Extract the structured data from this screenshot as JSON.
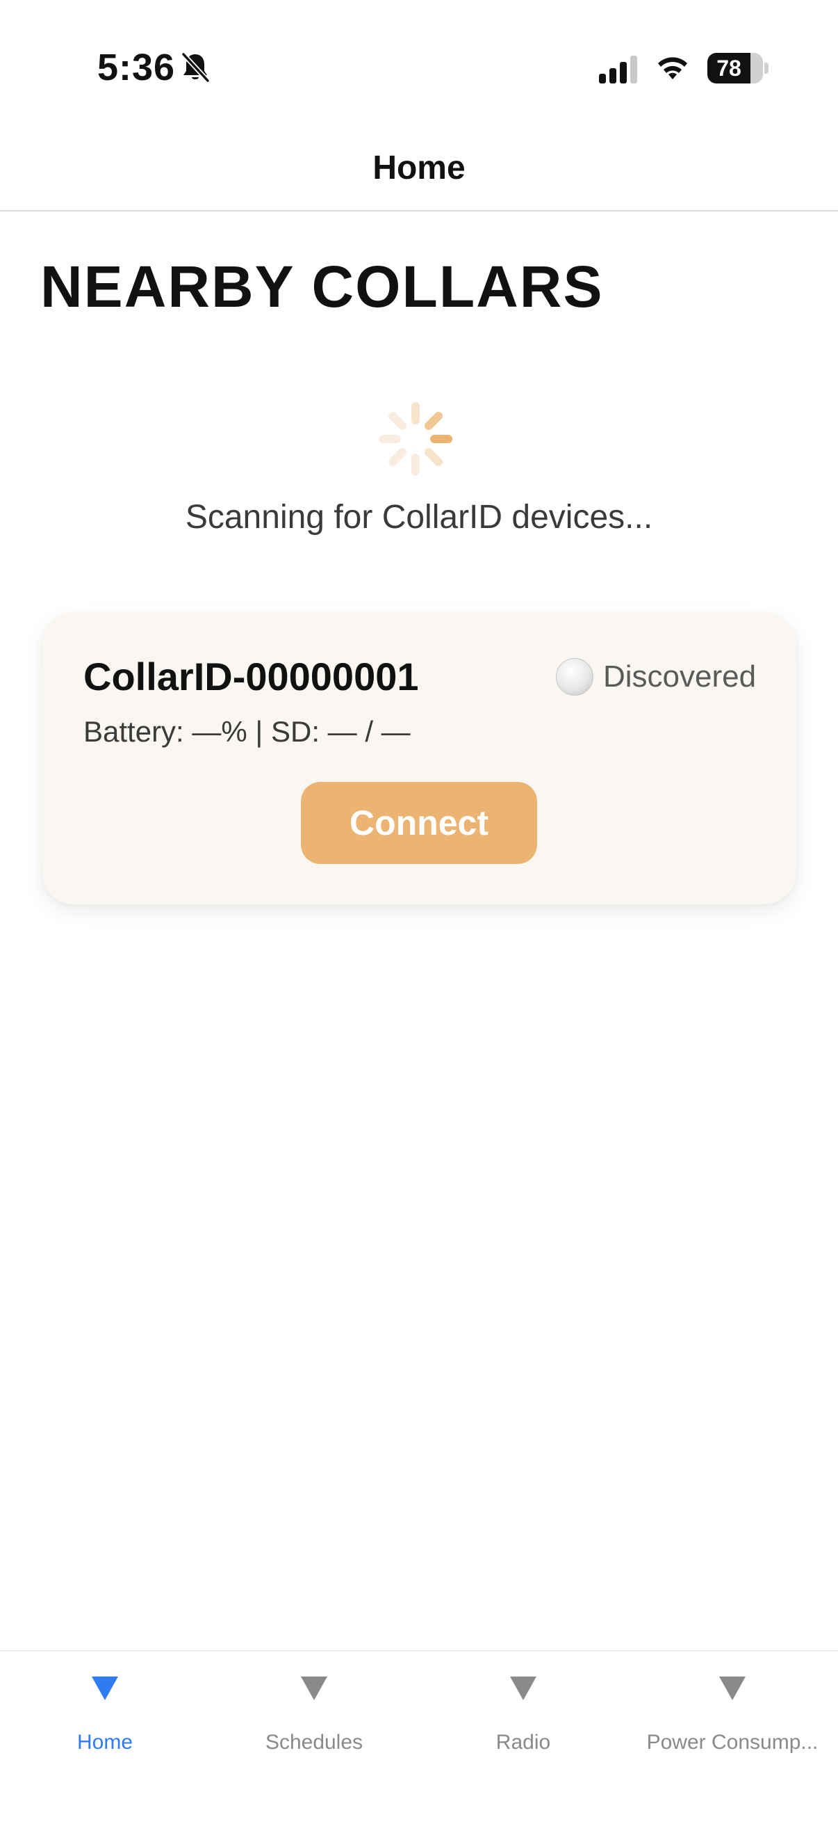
{
  "status_bar": {
    "time": "5:36",
    "battery_level": "78",
    "battery_fraction": 0.78,
    "icons": [
      "bell-slash-icon",
      "cellular-signal-icon",
      "wifi-icon",
      "battery-icon"
    ]
  },
  "header": {
    "title": "Home"
  },
  "main": {
    "section_title": "NEARBY COLLARS",
    "scanning_text": "Scanning for CollarID devices...",
    "spinner_icon": "activity-spinner-icon",
    "accent_color": "#ecb473",
    "devices": [
      {
        "name": "CollarID-00000001",
        "status": "Discovered",
        "status_icon": "status-dot-icon",
        "meta": "Battery: —% | SD: — / —",
        "connect_label": "Connect"
      }
    ]
  },
  "tab_bar": {
    "active_color": "#2f7bf0",
    "inactive_color": "#8a8a8a",
    "tabs": [
      {
        "label": "Home",
        "icon": "triangle-down-icon",
        "active": true
      },
      {
        "label": "Schedules",
        "icon": "triangle-down-icon",
        "active": false
      },
      {
        "label": "Radio",
        "icon": "triangle-down-icon",
        "active": false
      },
      {
        "label": "Power Consump...",
        "icon": "triangle-down-icon",
        "active": false
      }
    ]
  }
}
